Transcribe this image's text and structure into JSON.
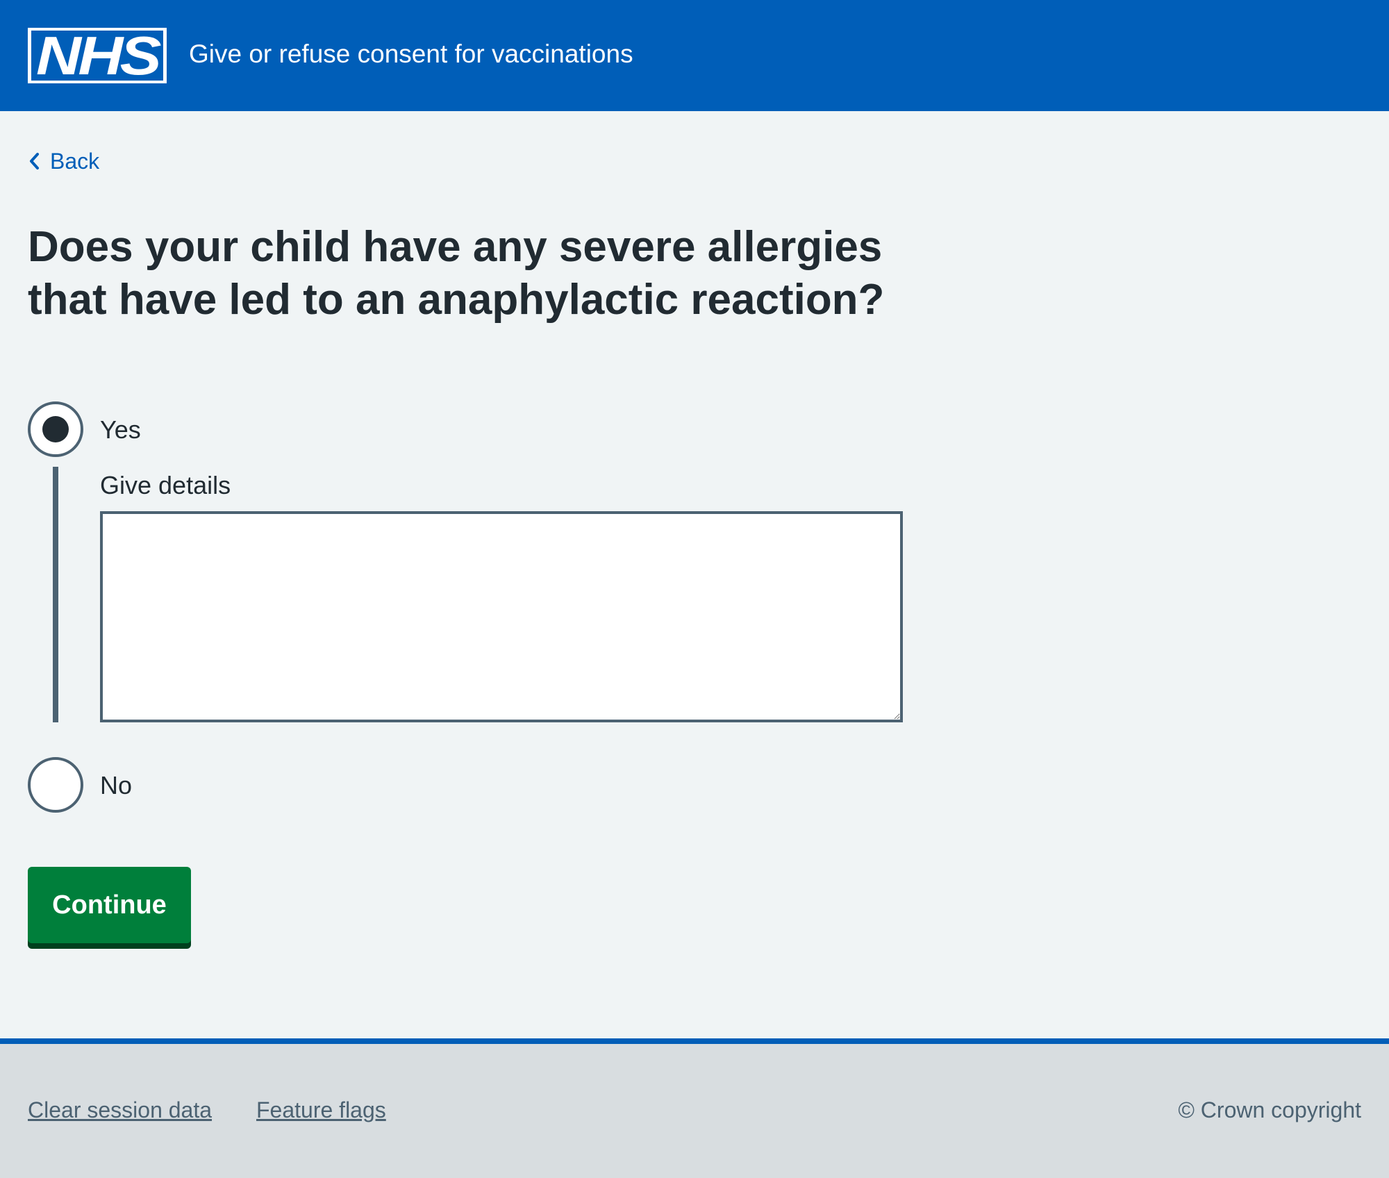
{
  "header": {
    "logo_text": "NHS",
    "service_name": "Give or refuse consent for vaccinations"
  },
  "back_link": {
    "label": "Back"
  },
  "question": {
    "heading": "Does your child have any severe allergies that have led to an anaphylactic reaction?"
  },
  "options": [
    {
      "label": "Yes",
      "checked": true
    },
    {
      "label": "No",
      "checked": false
    }
  ],
  "details": {
    "label": "Give details",
    "value": ""
  },
  "actions": {
    "continue_label": "Continue"
  },
  "footer": {
    "links": [
      "Clear session data",
      "Feature flags"
    ],
    "copyright": "© Crown copyright"
  },
  "colors": {
    "header": "#005eb8",
    "page_background": "#f0f4f5",
    "button": "#007f3b",
    "button_shadow": "#00401e",
    "footer": "#d8dde0",
    "text": "#212b32",
    "secondary_text": "#4c6272"
  }
}
